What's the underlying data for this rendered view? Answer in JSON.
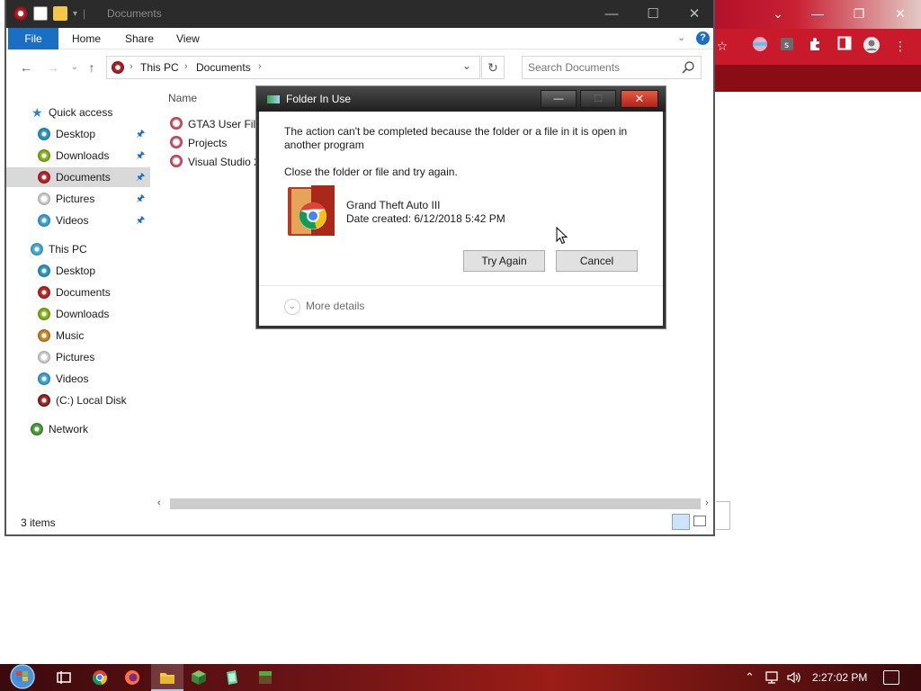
{
  "explorer": {
    "title": "Documents",
    "ribbon_tabs": [
      "File",
      "Home",
      "Share",
      "View"
    ],
    "breadcrumb": [
      "This PC",
      "Documents"
    ],
    "search": {
      "placeholder": "Search Documents",
      "value": ""
    },
    "column_header": "Name",
    "quick_access_label": "Quick access",
    "quick_access_items": [
      "Desktop",
      "Downloads",
      "Documents",
      "Pictures",
      "Videos"
    ],
    "this_pc_label": "This PC",
    "this_pc_items": [
      "Desktop",
      "Documents",
      "Downloads",
      "Music",
      "Pictures",
      "Videos",
      "(C:) Local Disk"
    ],
    "network_label": "Network",
    "files": [
      "GTA3 User Files",
      "Projects",
      "Visual Studio 2"
    ],
    "status": "3 items"
  },
  "dialog": {
    "title": "Folder In Use",
    "message": "The action can't be completed because the folder or a file in it is open in another program",
    "instruction": "Close the folder or file and try again.",
    "file_name": "Grand Theft Auto III",
    "file_date": "Date created: 6/12/2018 5:42 PM",
    "try_again_label": "Try Again",
    "cancel_label": "Cancel",
    "more_details_label": "More details"
  },
  "taskbar": {
    "time": "2:27:02 PM"
  },
  "icons": {
    "quick_access": "star-icon",
    "pin": "pin-icon",
    "search": "magnifier-icon",
    "refresh": "refresh-icon",
    "help": "help-icon"
  },
  "colors": {
    "file_tab": "#1a6fc4",
    "selection": "#d9d9d9",
    "dialog_close": "#c8331f",
    "browser_theme": "#c81a2b"
  }
}
